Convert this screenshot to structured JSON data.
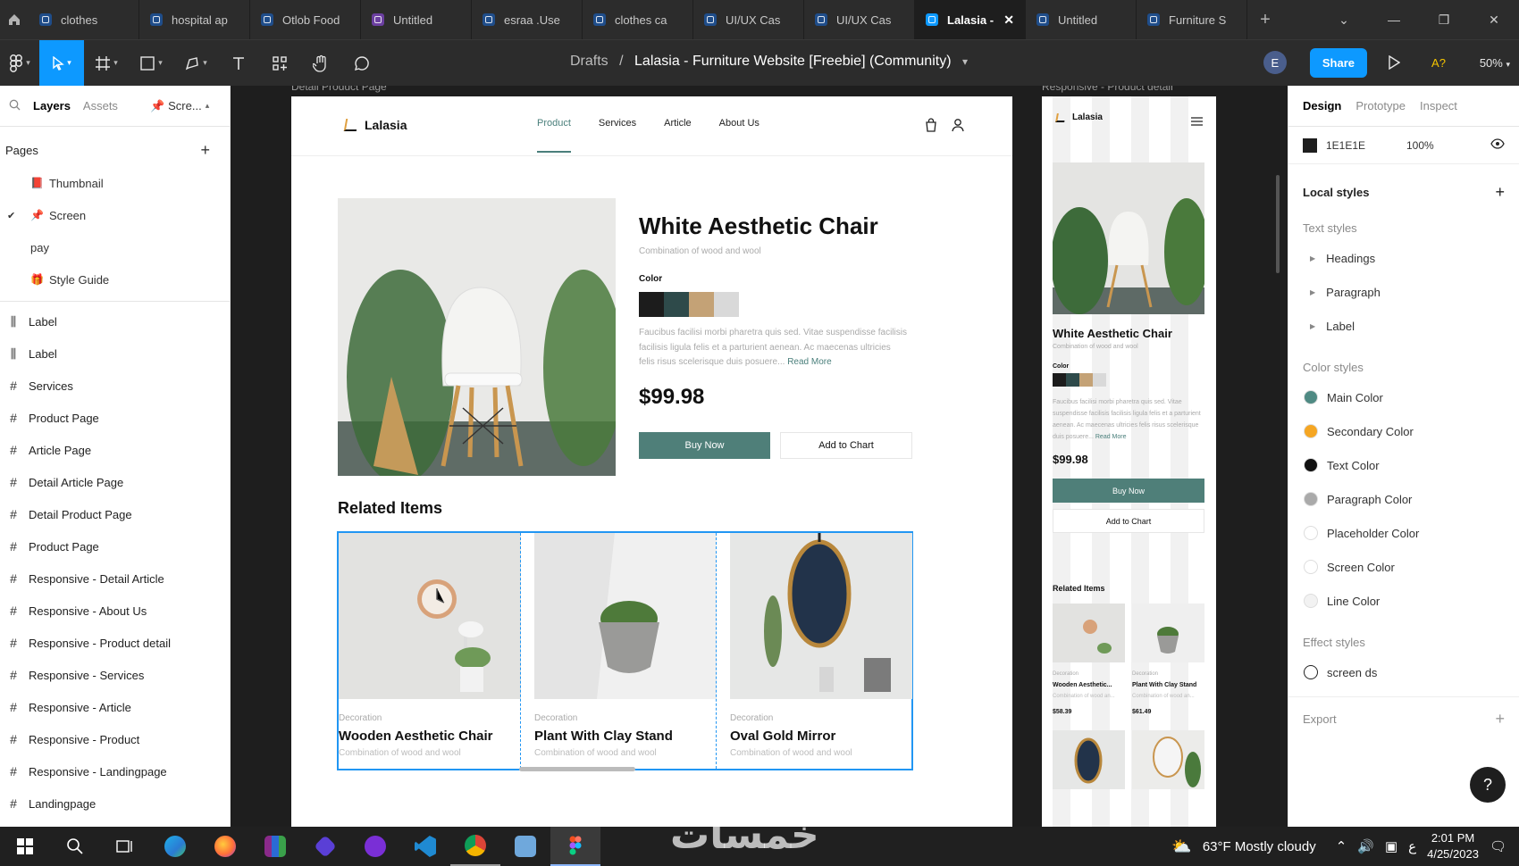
{
  "tabs": [
    {
      "label": "clothes",
      "color": "#1f4d8a"
    },
    {
      "label": "hospital ap",
      "color": "#1f4d8a"
    },
    {
      "label": "Otlob Food",
      "color": "#1f4d8a"
    },
    {
      "label": "Untitled",
      "color": "#6b3fa0"
    },
    {
      "label": "esraa .Use",
      "color": "#1f4d8a"
    },
    {
      "label": "clothes ca",
      "color": "#1f4d8a"
    },
    {
      "label": "UI/UX Cas",
      "color": "#1f4d8a"
    },
    {
      "label": "UI/UX Cas",
      "color": "#1f4d8a"
    },
    {
      "label": "Lalasia -",
      "color": "#0d99ff",
      "active": true
    },
    {
      "label": "Untitled",
      "color": "#1f4d8a"
    },
    {
      "label": "Furniture S",
      "color": "#1f4d8a"
    }
  ],
  "toolbar": {
    "drafts": "Drafts",
    "separator": "/",
    "file_name": "Lalasia - Furniture Website [Freebie] (Community)",
    "avatar": "E",
    "share": "Share",
    "font_warning": "A?",
    "zoom": "50%"
  },
  "left_panel": {
    "tabs": [
      "Layers",
      "Assets"
    ],
    "page_select": "Scre...",
    "pages_title": "Pages",
    "pages": [
      {
        "emoji": "📕",
        "label": "Thumbnail"
      },
      {
        "emoji": "📌",
        "label": "Screen",
        "current": true
      },
      {
        "emoji": "",
        "label": "pay"
      },
      {
        "emoji": "🎁",
        "label": "Style Guide"
      }
    ],
    "layers": [
      {
        "icon": "component",
        "label": "Label"
      },
      {
        "icon": "component",
        "label": "Label"
      },
      {
        "icon": "frame",
        "label": "Services"
      },
      {
        "icon": "frame",
        "label": "Product Page"
      },
      {
        "icon": "frame",
        "label": "Article Page"
      },
      {
        "icon": "frame",
        "label": "Detail Article Page"
      },
      {
        "icon": "frame",
        "label": "Detail Product Page"
      },
      {
        "icon": "frame",
        "label": "Product Page"
      },
      {
        "icon": "frame",
        "label": "Responsive - Detail Article"
      },
      {
        "icon": "frame",
        "label": "Responsive - About Us"
      },
      {
        "icon": "frame",
        "label": "Responsive - Product detail"
      },
      {
        "icon": "frame",
        "label": "Responsive - Services"
      },
      {
        "icon": "frame",
        "label": "Responsive - Article"
      },
      {
        "icon": "frame",
        "label": "Responsive - Product"
      },
      {
        "icon": "frame",
        "label": "Responsive - Landingpage"
      },
      {
        "icon": "frame",
        "label": "Landingpage"
      }
    ]
  },
  "canvas": {
    "frame1_label": "Detail Product Page",
    "frame2_label": "Responsive - Product detail",
    "site": {
      "logo": "Lalasia",
      "nav": [
        "Product",
        "Services",
        "Article",
        "About Us"
      ],
      "product_title": "White Aesthetic Chair",
      "product_sub": "Combination of wood and wool",
      "color_label": "Color",
      "swatches": [
        "#1c1c1c",
        "#2e4a4a",
        "#c4a276",
        "#d9d9d9"
      ],
      "description": "Faucibus facilisi morbi pharetra quis sed. Vitae suspendisse facilisis facilisis ligula felis et a parturient aenean. Ac maecenas ultricies felis risus scelerisque duis posuere...",
      "read_more": "Read More",
      "price": "$99.98",
      "buy_now": "Buy Now",
      "add_to_chart": "Add to Chart",
      "related_title": "Related Items",
      "related": [
        {
          "category": "Decoration",
          "name": "Wooden Aesthetic Chair",
          "sub": "Combination of wood and wool"
        },
        {
          "category": "Decoration",
          "name": "Plant With Clay Stand",
          "sub": "Combination of wood and wool"
        },
        {
          "category": "Decoration",
          "name": "Oval Gold Mirror",
          "sub": "Combination of wood and wool"
        }
      ]
    },
    "mobile": {
      "logo": "Lalasia",
      "title": "White Aesthetic Chair",
      "sub": "Combination of wood and wool",
      "color_label": "Color",
      "description": "Faucibus facilisi morbi pharetra quis sed. Vitae suspendisse facilisis facilisis ligula felis et a parturient aenean. Ac maecenas ultricies felis risus scelerisque duis posuere...",
      "read_more": "Read More",
      "price": "$99.98",
      "buy_now": "Buy Now",
      "add_to_chart": "Add to Chart",
      "related_title": "Related Items",
      "related": [
        {
          "category": "Decoration",
          "name": "Wooden Aesthetic...",
          "sub": "Combination of wood an...",
          "price": "$58.39"
        },
        {
          "category": "Decoration",
          "name": "Plant With Clay Stand",
          "sub": "Combination of wood an...",
          "price": "$61.49"
        }
      ]
    }
  },
  "right_panel": {
    "tabs": [
      "Design",
      "Prototype",
      "Inspect"
    ],
    "bg_hex": "1E1E1E",
    "bg_opacity": "100%",
    "local_styles": "Local styles",
    "text_styles_title": "Text styles",
    "text_styles": [
      "Headings",
      "Paragraph",
      "Label"
    ],
    "color_styles_title": "Color styles",
    "color_styles": [
      {
        "name": "Main Color",
        "color": "#4f8a83"
      },
      {
        "name": "Secondary Color",
        "color": "#f5a623"
      },
      {
        "name": "Text Color",
        "color": "#111111"
      },
      {
        "name": "Paragraph Color",
        "color": "#aaaaaa"
      },
      {
        "name": "Placeholder Color",
        "color": "#ffffff"
      },
      {
        "name": "Screen Color",
        "color": "#ffffff"
      },
      {
        "name": "Line Color",
        "color": "#f2f2f2"
      }
    ],
    "effect_styles_title": "Effect styles",
    "effect_style": "screen ds",
    "export": "Export",
    "help": "?"
  },
  "taskbar": {
    "weather": "63°F  Mostly cloudy",
    "lang": "ع",
    "time": "2:01 PM",
    "date": "4/25/2023"
  }
}
